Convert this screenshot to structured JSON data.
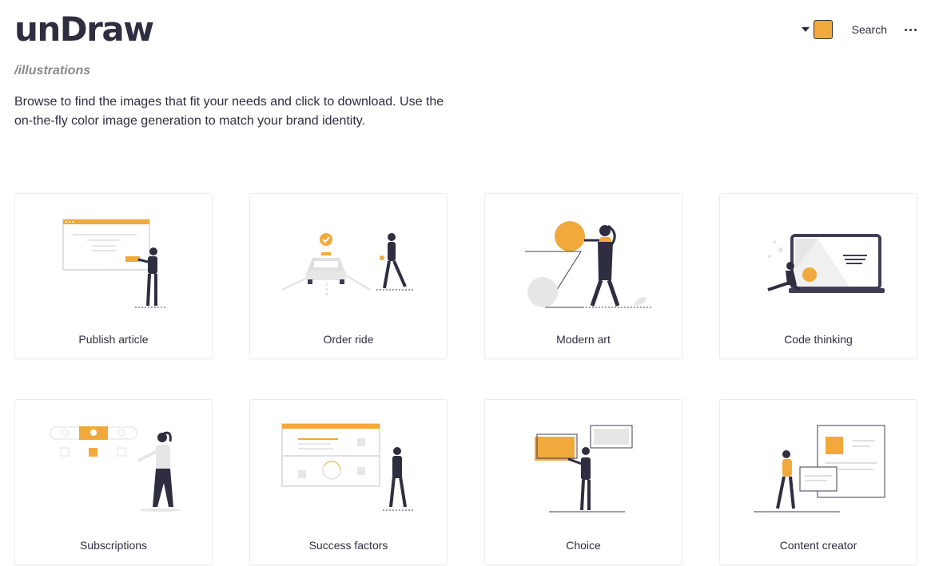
{
  "header": {
    "logo": "unDraw",
    "subtitle": "/illustrations",
    "intro": "Browse to find the images that fit your needs and click to download. Use the on-the-fly color image generation to match your brand identity.",
    "search_label": "Search",
    "accent_color": "#f2a93b",
    "icons": [
      "chevron-down-icon",
      "color-swatch-icon",
      "more-icon"
    ]
  },
  "illustrations": [
    {
      "title": "Publish article"
    },
    {
      "title": "Order ride"
    },
    {
      "title": "Modern art"
    },
    {
      "title": "Code thinking"
    },
    {
      "title": "Subscriptions"
    },
    {
      "title": "Success factors"
    },
    {
      "title": "Choice"
    },
    {
      "title": "Content creator"
    }
  ]
}
